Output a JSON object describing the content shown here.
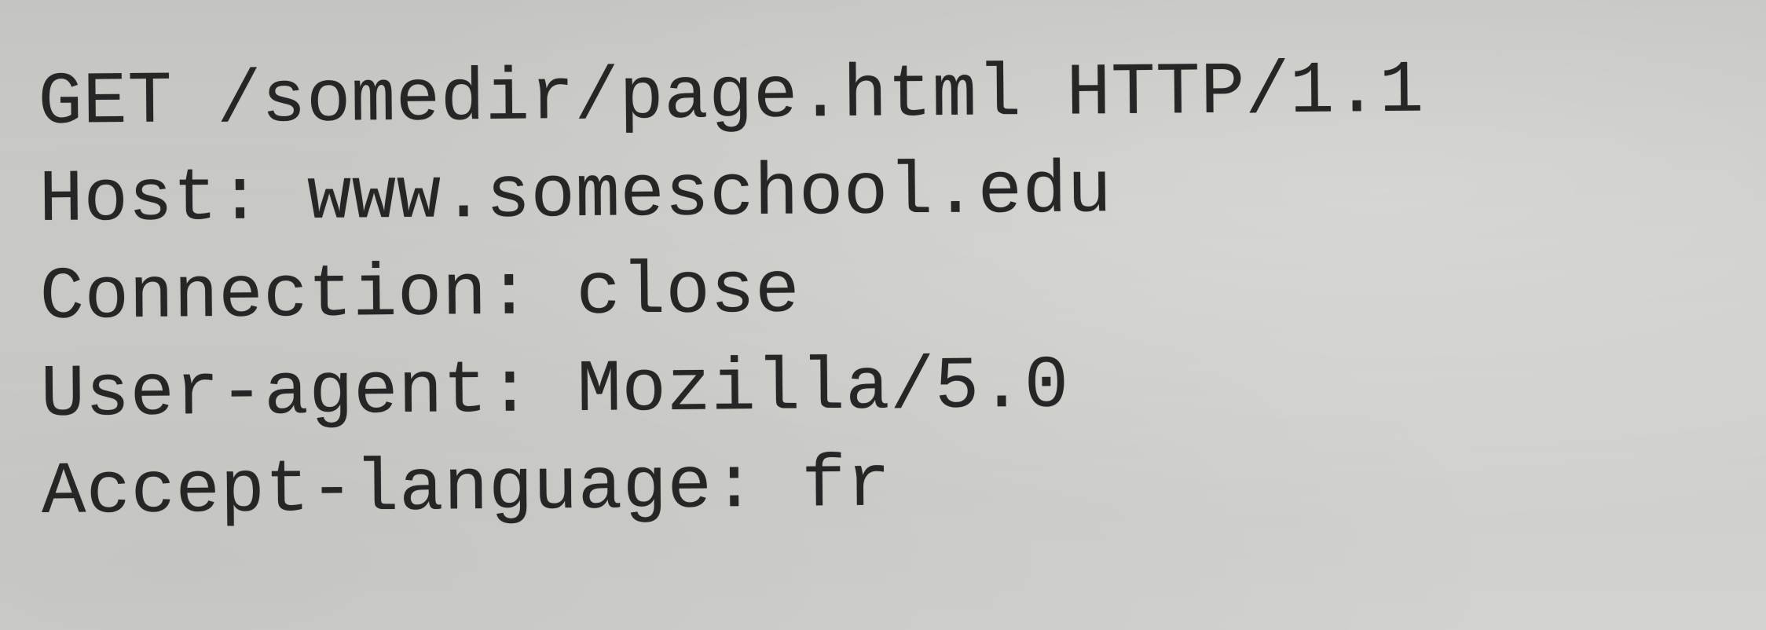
{
  "document": {
    "lines": [
      "GET /somedir/page.html HTTP/1.1",
      "Host: www.someschool.edu",
      "Connection: close",
      "User-agent: Mozilla/5.0",
      "Accept-language: fr"
    ]
  }
}
